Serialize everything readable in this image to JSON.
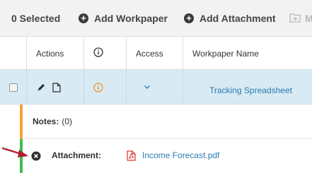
{
  "toolbar": {
    "selected_label": "0 Selected",
    "add_workpaper_label": "Add Workpaper",
    "add_attachment_label": "Add Attachment",
    "move_label": "M"
  },
  "table": {
    "columns": {
      "actions": "Actions",
      "info": "info-icon",
      "access": "Access",
      "workpaper_name": "Workpaper Name"
    },
    "row": {
      "workpaper_name": "Tracking Spreadsheet",
      "info_icon": "info-icon",
      "access_icon": "chevron-down-icon"
    }
  },
  "detail": {
    "notes_label": "Notes:",
    "notes_count": "(0)",
    "attachment_label": "Attachment:",
    "attachment_file": "Income Forecast.pdf"
  },
  "colors": {
    "accent_link": "#2a7ab0",
    "orange": "#f5a13a",
    "green": "#3cc04a",
    "arrow": "#b01e2a",
    "row_highlight": "#d8eaf3",
    "pdf_red": "#e0322f"
  }
}
